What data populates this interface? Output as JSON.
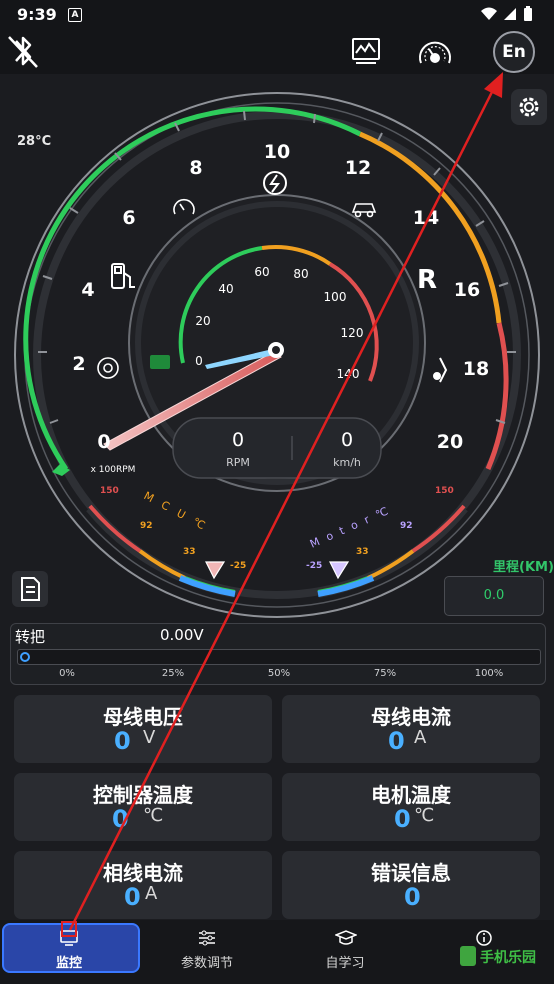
{
  "status_bar": {
    "time": "9:39",
    "notification_badge": "A"
  },
  "top_bar": {
    "language_button": "En"
  },
  "gauge": {
    "temperature": "28°C",
    "rpm_ticks": [
      "0",
      "2",
      "4",
      "6",
      "8",
      "10",
      "12",
      "14",
      "16",
      "18",
      "20"
    ],
    "rpm_unit": "x 100RPM",
    "speed_ticks": [
      "0",
      "20",
      "40",
      "60",
      "80",
      "100",
      "120",
      "140"
    ],
    "gear": "R",
    "rpm_value": "0",
    "rpm_label": "RPM",
    "speed_value": "0",
    "speed_label": "km/h",
    "mcu_temp_label": "MCU℃",
    "mcu_scale": [
      "150",
      "92",
      "33",
      "-25"
    ],
    "motor_temp_label": "Motor℃",
    "motor_scale": [
      "150",
      "92",
      "33",
      "-25"
    ]
  },
  "mileage": {
    "label": "里程(KM)",
    "value": "0.0"
  },
  "throttle": {
    "label": "转把",
    "value": "0.00V",
    "level": 0,
    "ticks": [
      "0%",
      "25%",
      "50%",
      "75%",
      "100%"
    ]
  },
  "cards": [
    {
      "title": "母线电压",
      "value": "0",
      "unit": "V"
    },
    {
      "title": "母线电流",
      "value": "0",
      "unit": "A"
    },
    {
      "title": "控制器温度",
      "value": "0",
      "unit": "℃"
    },
    {
      "title": "电机温度",
      "value": "0",
      "unit": "℃"
    },
    {
      "title": "相线电流",
      "value": "0",
      "unit": "A"
    },
    {
      "title": "错误信息",
      "value": "0",
      "unit": ""
    }
  ],
  "nav": [
    {
      "label": "监控"
    },
    {
      "label": "参数调节"
    },
    {
      "label": "自学习"
    },
    {
      "label": ""
    }
  ],
  "watermark": "手机乐园",
  "colors": {
    "green": "#2ecc5b",
    "orange": "#f0a020",
    "red": "#e05050",
    "accent_blue": "#4ab0ff",
    "active_nav": "#2a46a8"
  }
}
